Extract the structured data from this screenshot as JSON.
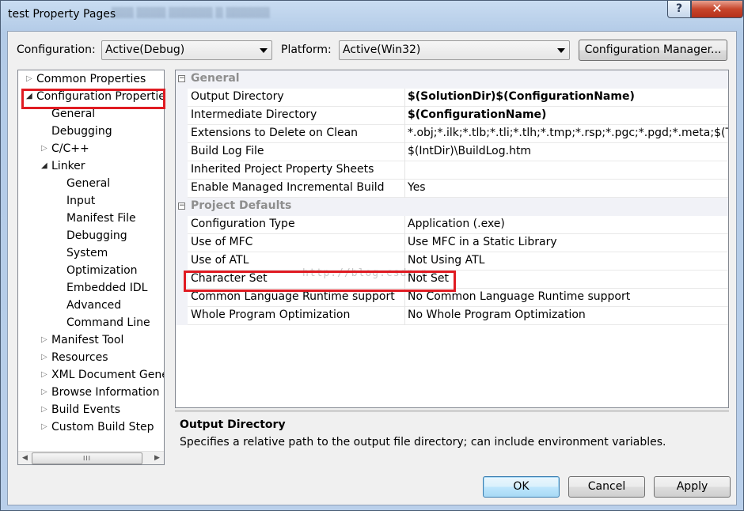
{
  "window": {
    "title": "test Property Pages",
    "help_label": "?",
    "close_label": "✕"
  },
  "top": {
    "configuration_label": "Configuration:",
    "configuration_value": "Active(Debug)",
    "platform_label": "Platform:",
    "platform_value": "Active(Win32)",
    "config_manager_label": "Configuration Manager..."
  },
  "tree": {
    "items": [
      {
        "label": "Common Properties",
        "expander": "▷"
      },
      {
        "label": "Configuration Properties",
        "expander": "◢"
      },
      {
        "label": "General",
        "expander": ""
      },
      {
        "label": "Debugging",
        "expander": ""
      },
      {
        "label": "C/C++",
        "expander": "▷"
      },
      {
        "label": "Linker",
        "expander": "◢"
      },
      {
        "label": "General",
        "expander": ""
      },
      {
        "label": "Input",
        "expander": ""
      },
      {
        "label": "Manifest File",
        "expander": ""
      },
      {
        "label": "Debugging",
        "expander": ""
      },
      {
        "label": "System",
        "expander": ""
      },
      {
        "label": "Optimization",
        "expander": ""
      },
      {
        "label": "Embedded IDL",
        "expander": ""
      },
      {
        "label": "Advanced",
        "expander": ""
      },
      {
        "label": "Command Line",
        "expander": ""
      },
      {
        "label": "Manifest Tool",
        "expander": "▷"
      },
      {
        "label": "Resources",
        "expander": "▷"
      },
      {
        "label": "XML Document Generator",
        "expander": "▷"
      },
      {
        "label": "Browse Information",
        "expander": "▷"
      },
      {
        "label": "Build Events",
        "expander": "▷"
      },
      {
        "label": "Custom Build Step",
        "expander": "▷"
      }
    ],
    "scroll_left": "◀",
    "scroll_right": "▶",
    "scroll_grip": "III"
  },
  "grid": {
    "categories": [
      {
        "label": "General",
        "toggle": "−"
      },
      {
        "label": "Project Defaults",
        "toggle": "−"
      }
    ],
    "general_rows": [
      {
        "name": "Output Directory",
        "value": "$(SolutionDir)$(ConfigurationName)",
        "bold": true
      },
      {
        "name": "Intermediate Directory",
        "value": "$(ConfigurationName)",
        "bold": true
      },
      {
        "name": "Extensions to Delete on Clean",
        "value": "*.obj;*.ilk;*.tlb;*.tli;*.tlh;*.tmp;*.rsp;*.pgc;*.pgd;*.meta;$(TargetPath)",
        "bold": false
      },
      {
        "name": "Build Log File",
        "value": "$(IntDir)\\BuildLog.htm",
        "bold": false
      },
      {
        "name": "Inherited Project Property Sheets",
        "value": "",
        "bold": false
      },
      {
        "name": "Enable Managed Incremental Build",
        "value": "Yes",
        "bold": false
      }
    ],
    "defaults_rows": [
      {
        "name": "Configuration Type",
        "value": "Application (.exe)",
        "bold": false
      },
      {
        "name": "Use of MFC",
        "value": "Use MFC in a Static Library",
        "bold": false
      },
      {
        "name": "Use of ATL",
        "value": "Not Using ATL",
        "bold": false
      },
      {
        "name": "Character Set",
        "value": "Not Set",
        "bold": false
      },
      {
        "name": "Common Language Runtime support",
        "value": "No Common Language Runtime support",
        "bold": false
      },
      {
        "name": "Whole Program Optimization",
        "value": "No Whole Program Optimization",
        "bold": false
      }
    ],
    "watermark": "http://blog.csdn.n"
  },
  "description": {
    "title": "Output Directory",
    "text": "Specifies a relative path to the output file directory; can include environment variables."
  },
  "buttons": {
    "ok": "OK",
    "cancel": "Cancel",
    "apply": "Apply"
  },
  "colors": {
    "highlight": "#e01b22",
    "category_bg": "#f1f2f7",
    "default_button": "#3c7fb1"
  }
}
